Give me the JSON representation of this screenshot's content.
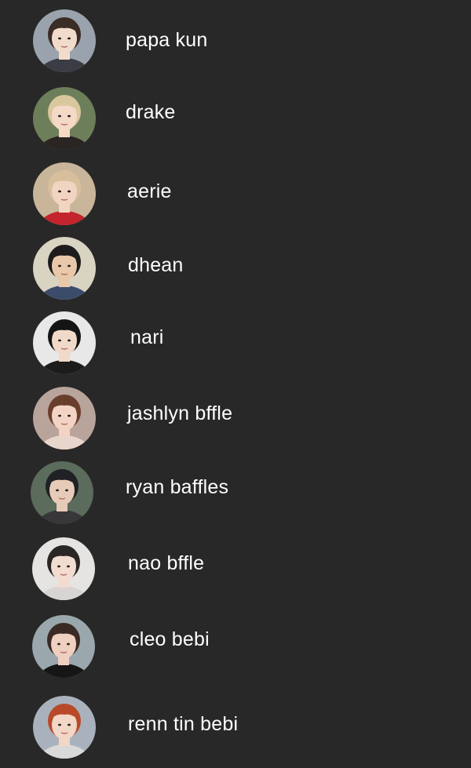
{
  "contacts": [
    {
      "name": "papa kun",
      "avatar_icon": "person-photo-avatar",
      "colors": {
        "bg": "#9aa3ad",
        "hair": "#3a2c26",
        "skin": "#f1dccb",
        "shirt": "#3b3d45"
      }
    },
    {
      "name": "drake",
      "avatar_icon": "person-photo-avatar",
      "colors": {
        "bg": "#6d7f5a",
        "hair": "#d9c79e",
        "skin": "#f3d9c6",
        "shirt": "#2a2422"
      }
    },
    {
      "name": "aerie",
      "avatar_icon": "person-photo-avatar",
      "colors": {
        "bg": "#c9b59a",
        "hair": "#d8bf9c",
        "skin": "#f2d4c2",
        "shirt": "#c4242c"
      }
    },
    {
      "name": "dhean",
      "avatar_icon": "person-photo-avatar",
      "colors": {
        "bg": "#d9d3c2",
        "hair": "#1d1b1c",
        "skin": "#e9c8aa",
        "shirt": "#3b4c6b"
      }
    },
    {
      "name": "nari",
      "avatar_icon": "person-photo-avatar",
      "colors": {
        "bg": "#e8e8e8",
        "hair": "#141414",
        "skin": "#f0d9c9",
        "shirt": "#1c1c1c"
      }
    },
    {
      "name": "jashlyn bffle",
      "avatar_icon": "person-photo-avatar",
      "colors": {
        "bg": "#b8a49a",
        "hair": "#6a3e2c",
        "skin": "#f3d4c4",
        "shirt": "#e8d6cc"
      }
    },
    {
      "name": "ryan baffles",
      "avatar_icon": "person-photo-avatar",
      "colors": {
        "bg": "#5b6b5c",
        "hair": "#1f2124",
        "skin": "#e6cbb8",
        "shirt": "#39363a"
      }
    },
    {
      "name": "nao bffle",
      "avatar_icon": "person-photo-avatar",
      "colors": {
        "bg": "#e6e4e2",
        "hair": "#2a2624",
        "skin": "#f1dccf",
        "shirt": "#d8d4d2"
      }
    },
    {
      "name": "cleo bebi",
      "avatar_icon": "person-photo-avatar",
      "colors": {
        "bg": "#9aa7ad",
        "hair": "#3a2a24",
        "skin": "#efcfc0",
        "shirt": "#161616"
      }
    },
    {
      "name": "renn tin bebi",
      "avatar_icon": "person-photo-avatar",
      "colors": {
        "bg": "#a9b2bc",
        "hair": "#b84a2a",
        "skin": "#f2d6c6",
        "shirt": "#d9d9d9"
      }
    }
  ]
}
